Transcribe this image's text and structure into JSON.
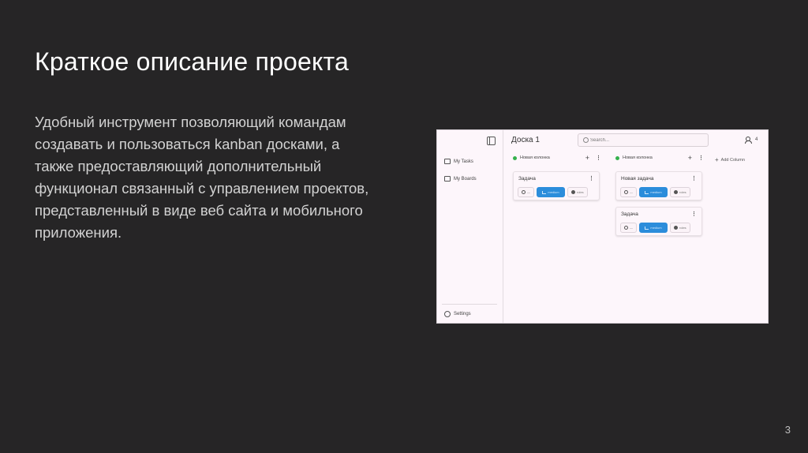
{
  "slide": {
    "title": "Краткое описание проекта",
    "body_lines": [
      "Удобный инструмент позволяющий командам",
      "создавать и пользоваться kanban досками, а",
      "также предоставляющий дополнительный",
      "функционал связанный с управлением проектов,",
      "представленный в виде веб сайта и мобильного",
      "приложения."
    ],
    "page_number": "3"
  },
  "app": {
    "sidebar": {
      "items": [
        {
          "label": "My Tasks",
          "icon": "book-icon"
        },
        {
          "label": "My Boards",
          "icon": "briefcase-icon"
        }
      ],
      "settings_label": "Settings"
    },
    "header": {
      "board_title": "Доска 1",
      "search_placeholder": "Search...",
      "members_count": "4"
    },
    "columns": [
      {
        "name": "Новая колонка",
        "dot_color": "#34b04c",
        "cards": [
          {
            "title": "Задача",
            "date": "—",
            "priority": "medium",
            "assignee": "roles"
          }
        ]
      },
      {
        "name": "Новая колонка",
        "dot_color": "#34b04c",
        "cards": [
          {
            "title": "Новая задача",
            "date": "—",
            "priority": "medium",
            "assignee": "roles"
          },
          {
            "title": "Задача",
            "date": "—",
            "priority": "medium",
            "assignee": "roles"
          }
        ]
      }
    ],
    "add_column_label": "Add Column",
    "colors": {
      "accent": "#2b8ddb",
      "status_dot": "#34b04c",
      "slide_bg": "#262526"
    }
  }
}
